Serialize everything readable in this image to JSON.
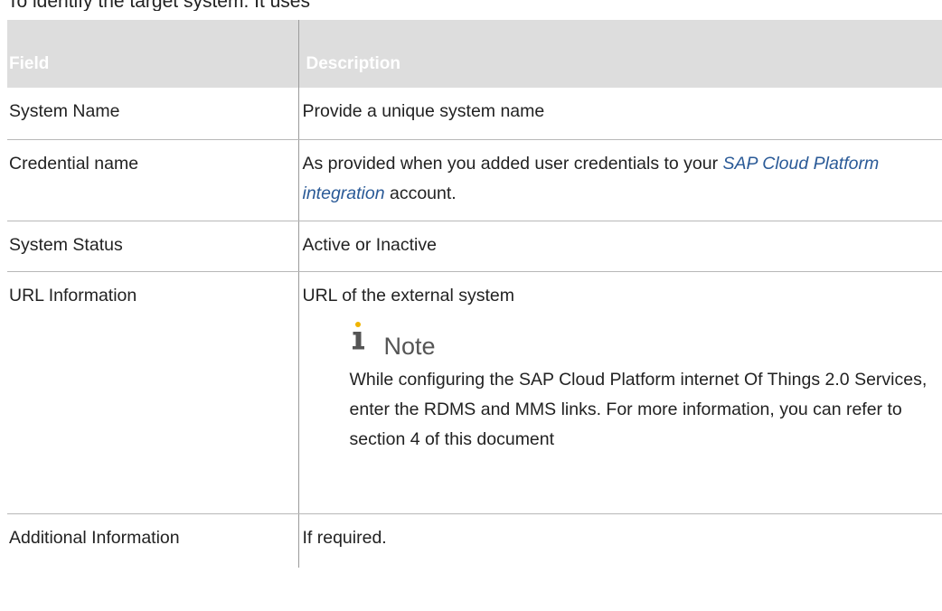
{
  "partial_text": "To identify the target system. It uses",
  "table": {
    "headers": [
      "Field",
      "Description"
    ],
    "rows": [
      {
        "field": "System Name",
        "description": "Provide a unique system name"
      },
      {
        "field": "Credential name",
        "desc_before": "As provided when you added user credentials to your ",
        "desc_link": "SAP Cloud Platform integration",
        "desc_after": " account."
      },
      {
        "field": "System Status",
        "description": "Active or Inactive"
      },
      {
        "field": "URL Information",
        "description": "URL of the external system",
        "note": {
          "title": "Note",
          "text": "While configuring the SAP Cloud Platform internet Of Things 2.0 Services, enter the RDMS and MMS links. For more information, you can refer to section 4 of this document"
        }
      },
      {
        "field": "Additional Information",
        "description": "If required."
      }
    ]
  },
  "colors": {
    "header_bg": "#dddddd",
    "header_text": "#ffffff",
    "link": "#2a5a97",
    "note_accent": "#f0b400"
  },
  "icons": {
    "note": "info-i-icon"
  }
}
